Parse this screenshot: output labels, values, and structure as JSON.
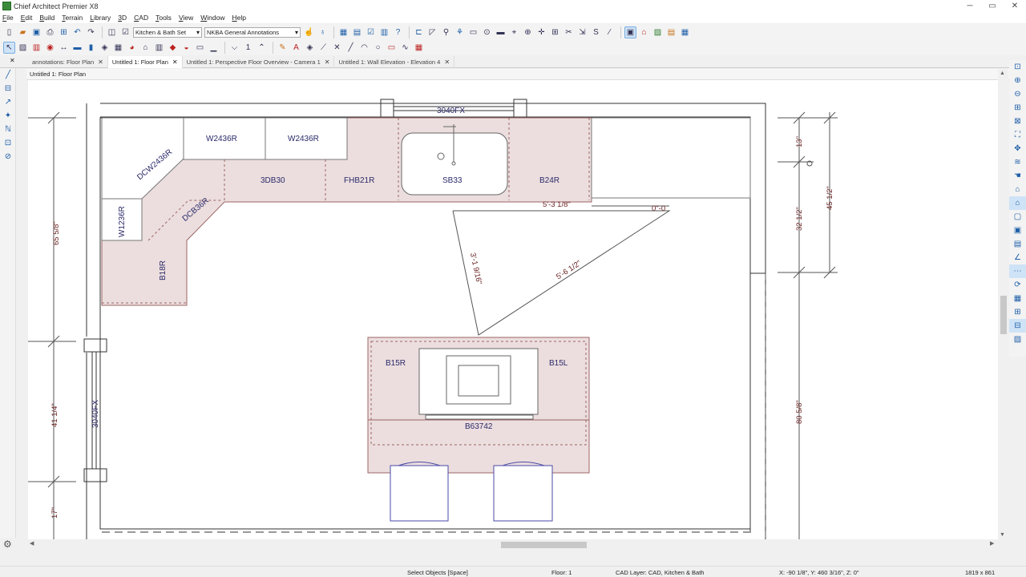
{
  "window": {
    "title": "Chief Architect Premier X8",
    "controls": [
      "─",
      "▭",
      "✕"
    ]
  },
  "menu": [
    "File",
    "Edit",
    "Build",
    "Terrain",
    "Library",
    "3D",
    "CAD",
    "Tools",
    "View",
    "Window",
    "Help"
  ],
  "toolbar": {
    "plan_set": "Kitchen & Bath Set",
    "annotation_set": "NKBA General Annotations",
    "floor_number": "1"
  },
  "tabs": [
    {
      "label": "annotations: Floor Plan",
      "active": false
    },
    {
      "label": "Untitled 1: Floor Plan",
      "active": true
    },
    {
      "label": "Untitled 1: Perspective Floor Overview - Camera 1",
      "active": false
    },
    {
      "label": "Untitled 1: Wall Elevation - Elevation 4",
      "active": false
    }
  ],
  "document": {
    "title": "Untitled 1: Floor Plan"
  },
  "plan": {
    "cabinets": {
      "dcw": "DCW2436R",
      "w1": "W2436R",
      "w2": "W2436R",
      "db": "DCB36R",
      "db30": "3DB30",
      "fhb": "FHB21R",
      "sb": "SB33",
      "b24": "B24R",
      "w12": "W1236R",
      "b18": "B18R",
      "b15r": "B15R",
      "b15l": "B15L",
      "b63": "B63742"
    },
    "windows": {
      "top": "3040FX",
      "left": "3040FX"
    },
    "dimensions": {
      "left_top": "65 5/8\"",
      "left_mid": "41 1/4\"",
      "left_bot": "17\"",
      "right_a": "13\"",
      "right_b": "32 1/2\"",
      "right_c": "45 1/2\"",
      "right_d": "80 5/8\"",
      "tri_top": "5'-3 1/8\"",
      "tri_left": "3'-1 9/16\"",
      "tri_hyp": "5'-6 1/2\"",
      "zero": "0\"-0"
    }
  },
  "status": {
    "mode": "Select Objects [Space]",
    "floor": "Floor: 1",
    "layer": "CAD Layer: CAD, Kitchen & Bath",
    "coords": "X: -90 1/8\", Y: 460 3/16\", Z: 0\"",
    "resolution": "1819 x 861"
  }
}
